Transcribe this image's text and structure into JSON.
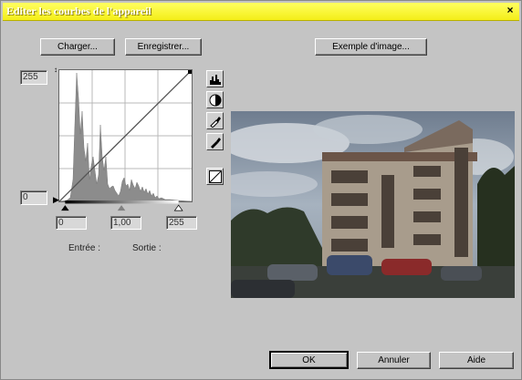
{
  "window": {
    "title": "Editer les courbes de l'appareil",
    "close_glyph": "×"
  },
  "toolbar": {
    "load_label": "Charger...",
    "save_label": "Enregistrer...",
    "sample_label": "Exemple d'image..."
  },
  "curve": {
    "output_max": "255",
    "output_min": "0",
    "input_min": "0",
    "gamma": "1,00",
    "input_max": "255",
    "input_label": "Entrée :",
    "output_label": "Sortie :"
  },
  "tools": [
    "histogram-icon",
    "contrast-icon",
    "black-eyedropper-icon",
    "white-eyedropper-icon",
    "curve-reset-icon"
  ],
  "footer": {
    "ok_label": "OK",
    "cancel_label": "Annuler",
    "help_label": "Aide"
  },
  "colors": {
    "title_bar": "#f4ee18",
    "dialog_bg": "#c4c4c4"
  }
}
